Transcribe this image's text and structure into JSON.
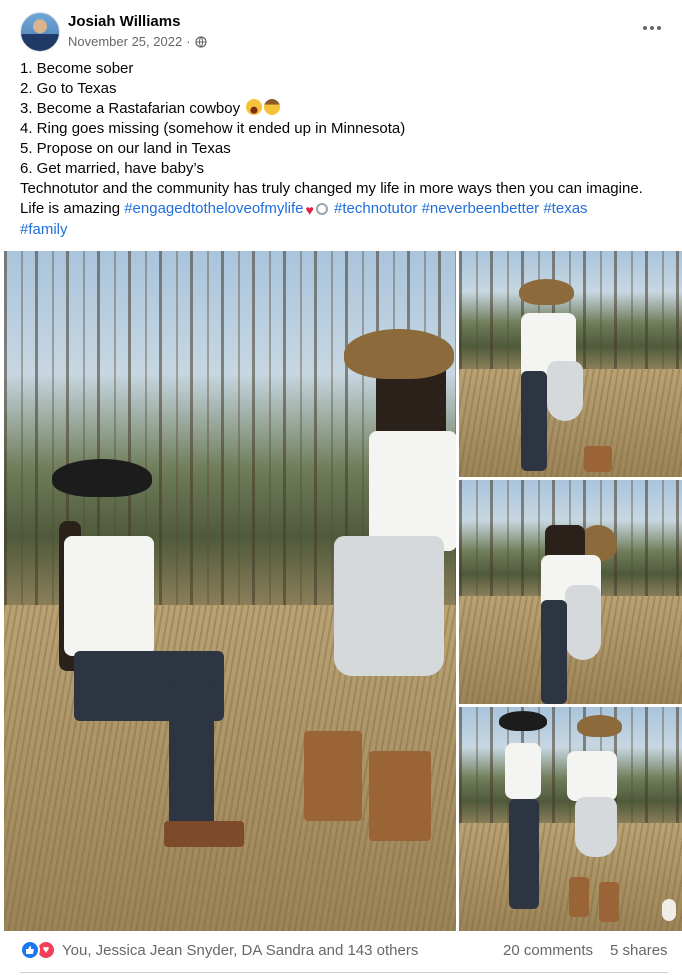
{
  "post": {
    "author": "Josiah Williams",
    "date": "November 25, 2022",
    "date_separator": "·",
    "privacy_icon": "globe-icon",
    "more_icon": "more-horizontal-icon",
    "lines": [
      "1. Become sober",
      "2. Go to Texas",
      "3. Become a Rastafarian cowboy",
      "4. Ring goes missing (somehow it ended up in Minnesota)",
      "5. Propose on our land in Texas",
      "6. Get married, have baby’s",
      "Technotutor and the community has truly changed my life in more ways then you can imagine."
    ],
    "last_line_prefix": "Life is amazing ",
    "hashtags": [
      "#engagedtotheloveofmylife",
      "#technotutor",
      "#neverbeenbetter",
      "#texas",
      "#family"
    ],
    "emojis": [
      "laughing-emoji",
      "cowboy-emoji",
      "heart-emoji",
      "ring-emoji"
    ]
  },
  "photos": [
    "photo-proposal-kneeling",
    "photo-hug-1",
    "photo-hug-2",
    "photo-holding-hands"
  ],
  "footer": {
    "reactions_text": "You, Jessica Jean Snyder, DA Sandra and 143 others",
    "reaction_icons": [
      "like-icon",
      "love-icon"
    ],
    "comments": "20 comments",
    "shares": "5 shares"
  },
  "colors": {
    "link": "#216fdb",
    "secondary_text": "#65676b",
    "like": "#1877f2",
    "love": "#f33e58"
  }
}
